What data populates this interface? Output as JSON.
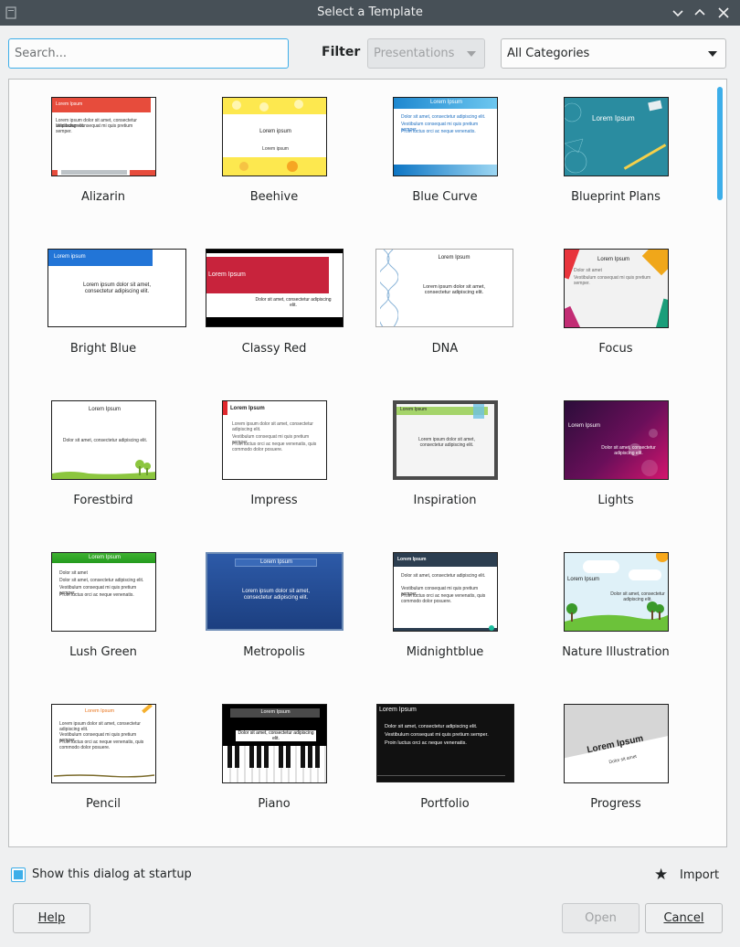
{
  "window": {
    "title": "Select a Template"
  },
  "search": {
    "placeholder": "Search...",
    "value": ""
  },
  "filter": {
    "label": "Filter",
    "type_value": "Presentations",
    "category_value": "All Categories"
  },
  "templates": [
    {
      "name": "Alizarin"
    },
    {
      "name": "Beehive"
    },
    {
      "name": "Blue Curve"
    },
    {
      "name": "Blueprint Plans"
    },
    {
      "name": "Bright Blue"
    },
    {
      "name": "Classy Red"
    },
    {
      "name": "DNA"
    },
    {
      "name": "Focus"
    },
    {
      "name": "Forestbird"
    },
    {
      "name": "Impress"
    },
    {
      "name": "Inspiration"
    },
    {
      "name": "Lights"
    },
    {
      "name": "Lush Green"
    },
    {
      "name": "Metropolis"
    },
    {
      "name": "Midnightblue"
    },
    {
      "name": "Nature Illustration"
    },
    {
      "name": "Pencil"
    },
    {
      "name": "Piano"
    },
    {
      "name": "Portfolio"
    },
    {
      "name": "Progress"
    }
  ],
  "thumb_text": {
    "lorem_ipsum": "Lorem Ipsum",
    "lorem_ipsum_lc": "Lorem ipsum",
    "dolor": "Dolor sit amet, consectetur adipiscing elit.",
    "dolor_short": "Dolor sit amet",
    "lorem_full": "Lorem ipsum dolor sit amet, consectetur adipiscing elit.",
    "vestibulum": "Vestibulum consequat mi quis pretium semper.",
    "proin": "Proin luctus orci ac neque venenatis, quis commodo dolor posuere.",
    "proin_short": "Proin luctus orci ac neque venenatis."
  },
  "footer": {
    "show_at_startup_label": "Show this dialog at startup",
    "show_at_startup_checked": true,
    "import_label": "Import",
    "help_label": "Help",
    "open_label": "Open",
    "cancel_label": "Cancel"
  },
  "colors": {
    "accent": "#3daee9",
    "titlebar": "#475057"
  }
}
